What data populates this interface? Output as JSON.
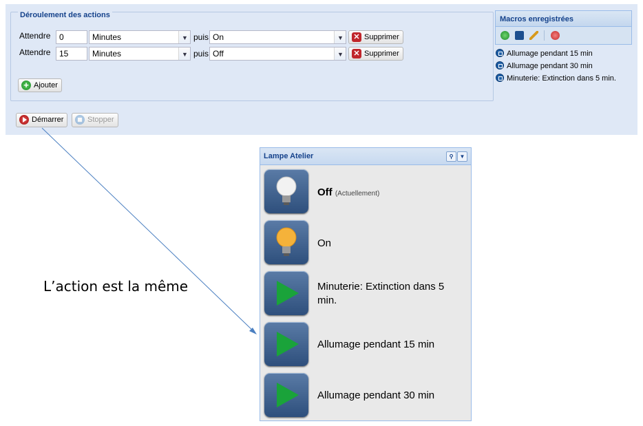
{
  "actions_panel": {
    "title": "Déroulement des actions",
    "rows": [
      {
        "wait_label": "Attendre",
        "delay": "0",
        "unit": "Minutes",
        "then_label": "puis",
        "action": "On",
        "delete_label": "Supprimer"
      },
      {
        "wait_label": "Attendre",
        "delay": "15",
        "unit": "Minutes",
        "then_label": "puis",
        "action": "Off",
        "delete_label": "Supprimer"
      }
    ],
    "add_label": "Ajouter"
  },
  "controls": {
    "start_label": "Démarrer",
    "stop_label": "Stopper"
  },
  "macros": {
    "title": "Macros enregistrées",
    "items": [
      "Allumage pendant 15 min",
      "Allumage pendant 30 min",
      "Minuterie: Extinction dans 5 min."
    ]
  },
  "lamp_panel": {
    "title": "Lampe Atelier",
    "status": {
      "value": "Off",
      "note": "(Actuellement)"
    },
    "actions": [
      {
        "icon": "bulb-off-icon",
        "label": "Off"
      },
      {
        "icon": "bulb-on-icon",
        "label": "On"
      },
      {
        "icon": "play-icon",
        "label": "Minuterie: Extinction dans 5 min."
      },
      {
        "icon": "play-icon",
        "label": "Allumage pendant 15 min"
      },
      {
        "icon": "play-icon",
        "label": "Allumage pendant 30 min"
      }
    ]
  },
  "annotation": "L’action est la même",
  "colors": {
    "header_text": "#15428b",
    "panel_bg": "#dfe8f6",
    "arrow": "#4a7fc1"
  }
}
